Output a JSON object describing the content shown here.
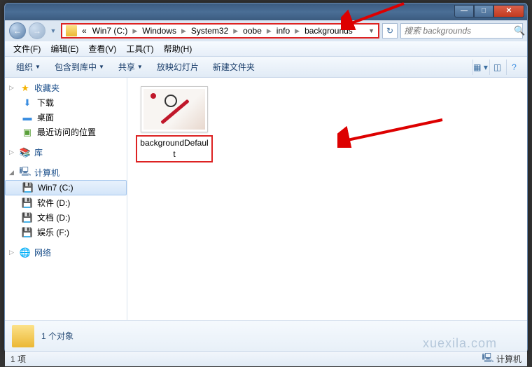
{
  "titlebar": {
    "min": "—",
    "max": "□",
    "close": "✕"
  },
  "nav": {
    "back": "←",
    "forward": "→"
  },
  "address": {
    "prefix": "«",
    "segments": [
      "Win7 (C:)",
      "Windows",
      "System32",
      "oobe",
      "info",
      "backgrounds"
    ]
  },
  "search": {
    "placeholder": "搜索 backgrounds",
    "icon": "🔍"
  },
  "menu": {
    "file": "文件(F)",
    "edit": "编辑(E)",
    "view": "查看(V)",
    "tools": "工具(T)",
    "help": "帮助(H)"
  },
  "toolbar": {
    "organize": "组织",
    "include": "包含到库中",
    "share": "共享",
    "slideshow": "放映幻灯片",
    "newfolder": "新建文件夹"
  },
  "sidebar": {
    "favorites": {
      "label": "收藏夹",
      "items": [
        "下载",
        "桌面",
        "最近访问的位置"
      ]
    },
    "libraries": {
      "label": "库"
    },
    "computer": {
      "label": "计算机",
      "items": [
        "Win7 (C:)",
        "软件 (D:)",
        "文档 (D:)",
        "娱乐 (F:)"
      ]
    },
    "network": {
      "label": "网络"
    }
  },
  "content": {
    "file_label": "backgroundDefault"
  },
  "details": {
    "text": "1 个对象"
  },
  "status": {
    "left": "1 项",
    "right_label": "计算机"
  },
  "watermark": "xuexila.com"
}
